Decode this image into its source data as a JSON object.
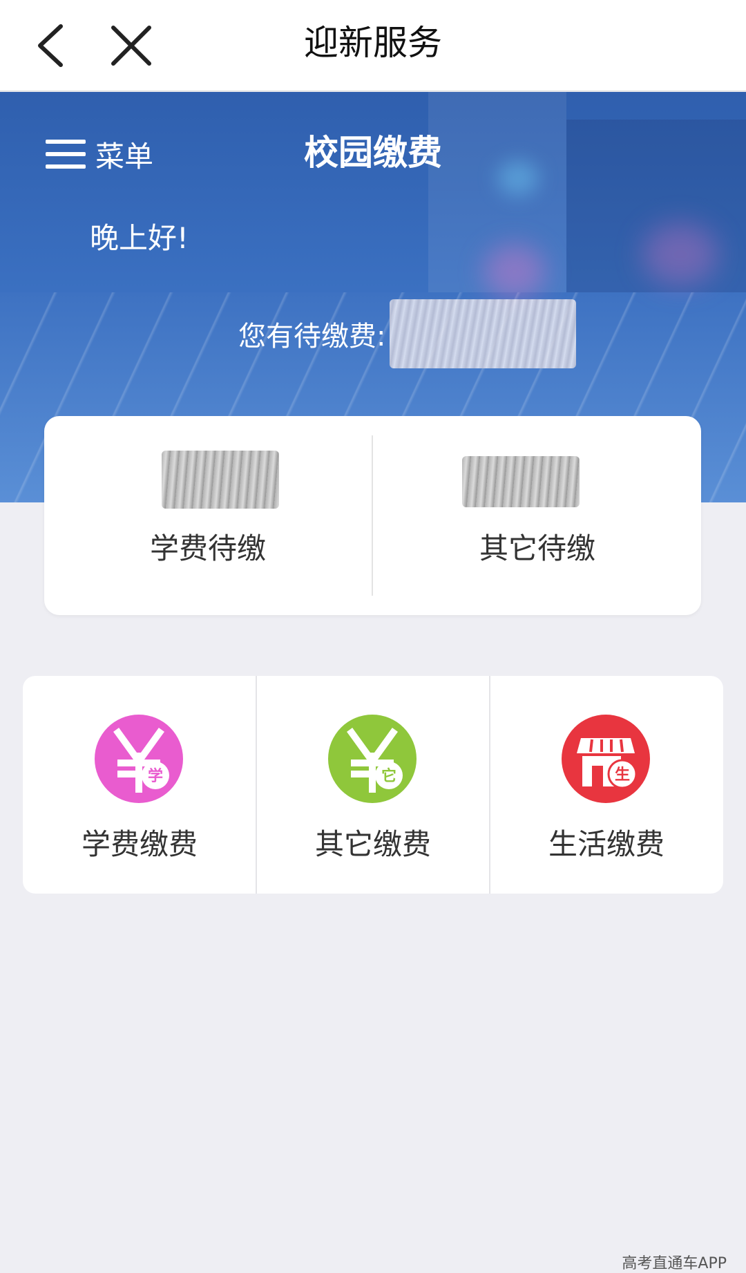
{
  "topbar": {
    "title": "迎新服务",
    "back_icon": "chevron-left-icon",
    "close_icon": "close-icon"
  },
  "hero": {
    "menu_label": "菜单",
    "title": "校园缴费",
    "greeting": "晚上好!",
    "pending_label": "您有待缴费:"
  },
  "summary": {
    "tuition_pending_label": "学费待缴",
    "other_pending_label": "其它待缴"
  },
  "actions": [
    {
      "label": "学费缴费",
      "icon": "yuan-tuition-icon",
      "badge": "学",
      "color": "#e95ccf"
    },
    {
      "label": "其它缴费",
      "icon": "yuan-other-icon",
      "badge": "它",
      "color": "#8fc73b"
    },
    {
      "label": "生活缴费",
      "icon": "store-icon",
      "badge": "生",
      "color": "#e8353f"
    }
  ],
  "watermark": "高考直通车APP"
}
